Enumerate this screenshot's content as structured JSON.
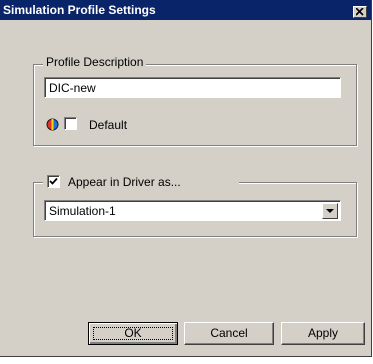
{
  "window": {
    "title": "Simulation Profile Settings"
  },
  "profile_group": {
    "legend": "Profile Description",
    "description_value": "DIC-new",
    "default_label": "Default",
    "default_checked": false
  },
  "driver_group": {
    "checkbox_label": "Appear in Driver as...",
    "checkbox_checked": true,
    "selected_value": "Simulation-1"
  },
  "buttons": {
    "ok": "OK",
    "cancel": "Cancel",
    "apply": "Apply"
  },
  "colors": {
    "titlebar": "#0a246a",
    "face": "#d4d0c8"
  }
}
